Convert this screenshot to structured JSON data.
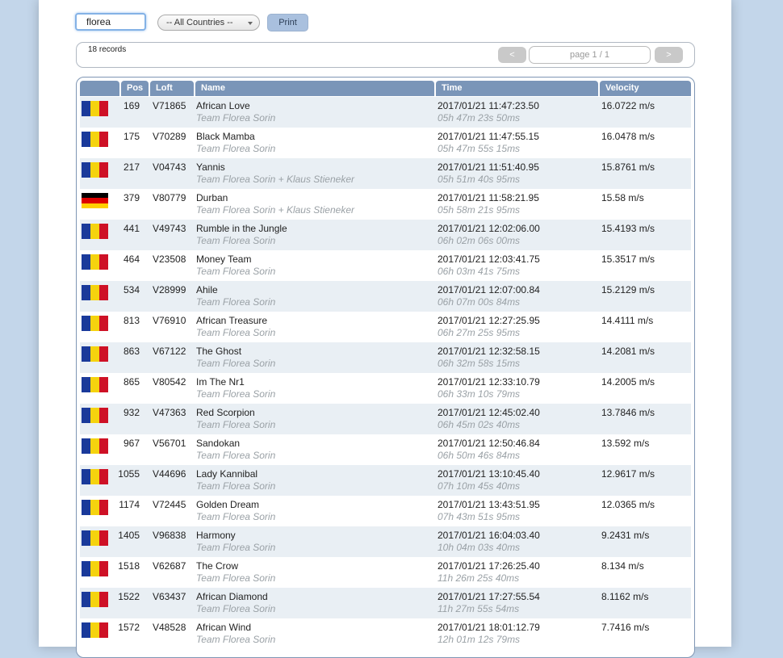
{
  "toolbar": {
    "search_value": "florea",
    "country_select": "-- All Countries --",
    "print_label": "Print"
  },
  "records": {
    "count_label": "18 records",
    "prev_label": "<",
    "next_label": ">",
    "page_label": "page 1 / 1"
  },
  "table": {
    "headers": {
      "flag": "",
      "pos": "Pos",
      "loft": "Loft",
      "name": "Name",
      "time": "Time",
      "velocity": "Velocity"
    },
    "rows": [
      {
        "flag": "RO",
        "pos": "169",
        "loft": "V71865",
        "name": "African Love",
        "team": "Team Florea Sorin",
        "time": "2017/01/21 11:47:23.50",
        "elapsed": "05h 47m 23s 50ms",
        "velocity": "16.0722 m/s"
      },
      {
        "flag": "RO",
        "pos": "175",
        "loft": "V70289",
        "name": "Black Mamba",
        "team": "Team Florea Sorin",
        "time": "2017/01/21 11:47:55.15",
        "elapsed": "05h 47m 55s 15ms",
        "velocity": "16.0478 m/s"
      },
      {
        "flag": "RO",
        "pos": "217",
        "loft": "V04743",
        "name": "Yannis",
        "team": "Team Florea Sorin + Klaus Stieneker",
        "time": "2017/01/21 11:51:40.95",
        "elapsed": "05h 51m 40s 95ms",
        "velocity": "15.8761 m/s"
      },
      {
        "flag": "DE",
        "pos": "379",
        "loft": "V80779",
        "name": "Durban",
        "team": "Team Florea Sorin + Klaus Stieneker",
        "time": "2017/01/21 11:58:21.95",
        "elapsed": "05h 58m 21s 95ms",
        "velocity": "15.58 m/s"
      },
      {
        "flag": "RO",
        "pos": "441",
        "loft": "V49743",
        "name": "Rumble in the Jungle",
        "team": "Team Florea Sorin",
        "time": "2017/01/21 12:02:06.00",
        "elapsed": "06h 02m 06s 00ms",
        "velocity": "15.4193 m/s"
      },
      {
        "flag": "RO",
        "pos": "464",
        "loft": "V23508",
        "name": "Money Team",
        "team": "Team Florea Sorin",
        "time": "2017/01/21 12:03:41.75",
        "elapsed": "06h 03m 41s 75ms",
        "velocity": "15.3517 m/s"
      },
      {
        "flag": "RO",
        "pos": "534",
        "loft": "V28999",
        "name": "Ahile",
        "team": "Team Florea Sorin",
        "time": "2017/01/21 12:07:00.84",
        "elapsed": "06h 07m 00s 84ms",
        "velocity": "15.2129 m/s"
      },
      {
        "flag": "RO",
        "pos": "813",
        "loft": "V76910",
        "name": "African Treasure",
        "team": "Team Florea Sorin",
        "time": "2017/01/21 12:27:25.95",
        "elapsed": "06h 27m 25s 95ms",
        "velocity": "14.4111 m/s"
      },
      {
        "flag": "RO",
        "pos": "863",
        "loft": "V67122",
        "name": "The Ghost",
        "team": "Team Florea Sorin",
        "time": "2017/01/21 12:32:58.15",
        "elapsed": "06h 32m 58s 15ms",
        "velocity": "14.2081 m/s"
      },
      {
        "flag": "RO",
        "pos": "865",
        "loft": "V80542",
        "name": "Im The Nr1",
        "team": "Team Florea Sorin",
        "time": "2017/01/21 12:33:10.79",
        "elapsed": "06h 33m 10s 79ms",
        "velocity": "14.2005 m/s"
      },
      {
        "flag": "RO",
        "pos": "932",
        "loft": "V47363",
        "name": "Red Scorpion",
        "team": "Team Florea Sorin",
        "time": "2017/01/21 12:45:02.40",
        "elapsed": "06h 45m 02s 40ms",
        "velocity": "13.7846 m/s"
      },
      {
        "flag": "RO",
        "pos": "967",
        "loft": "V56701",
        "name": "Sandokan",
        "team": "Team Florea Sorin",
        "time": "2017/01/21 12:50:46.84",
        "elapsed": "06h 50m 46s 84ms",
        "velocity": "13.592 m/s"
      },
      {
        "flag": "RO",
        "pos": "1055",
        "loft": "V44696",
        "name": "Lady Kannibal",
        "team": "Team Florea Sorin",
        "time": "2017/01/21 13:10:45.40",
        "elapsed": "07h 10m 45s 40ms",
        "velocity": "12.9617 m/s"
      },
      {
        "flag": "RO",
        "pos": "1174",
        "loft": "V72445",
        "name": "Golden Dream",
        "team": "Team Florea Sorin",
        "time": "2017/01/21 13:43:51.95",
        "elapsed": "07h 43m 51s 95ms",
        "velocity": "12.0365 m/s"
      },
      {
        "flag": "RO",
        "pos": "1405",
        "loft": "V96838",
        "name": "Harmony",
        "team": "Team Florea Sorin",
        "time": "2017/01/21 16:04:03.40",
        "elapsed": "10h 04m 03s 40ms",
        "velocity": "9.2431 m/s"
      },
      {
        "flag": "RO",
        "pos": "1518",
        "loft": "V62687",
        "name": "The Crow",
        "team": "Team Florea Sorin",
        "time": "2017/01/21 17:26:25.40",
        "elapsed": "11h 26m 25s 40ms",
        "velocity": "8.134 m/s"
      },
      {
        "flag": "RO",
        "pos": "1522",
        "loft": "V63437",
        "name": "African Diamond",
        "team": "Team Florea Sorin",
        "time": "2017/01/21 17:27:55.54",
        "elapsed": "11h 27m 55s 54ms",
        "velocity": "8.1162 m/s"
      },
      {
        "flag": "RO",
        "pos": "1572",
        "loft": "V48528",
        "name": "African Wind",
        "team": "Team Florea Sorin",
        "time": "2017/01/21 18:01:12.79",
        "elapsed": "12h 01m 12s 79ms",
        "velocity": "7.7416 m/s"
      }
    ]
  },
  "colors": {
    "flag_RO": [
      "#1a3a9a",
      "#f5d30e",
      "#ce1126"
    ],
    "flag_DE": [
      "#000000",
      "#dd0000",
      "#ffce00"
    ],
    "header_bg": "#7a95b8",
    "row_alt": "#e9eff4"
  }
}
